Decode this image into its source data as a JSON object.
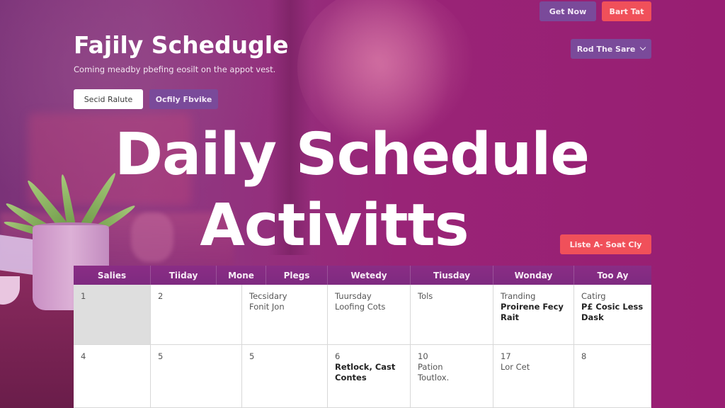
{
  "header": {
    "buttons": {
      "get_now": "Get Now",
      "start_tab": "Bart Tat",
      "read_select": "Rod The Sare"
    },
    "title": "Fajily Schedugle",
    "subtitle": "Coming meadby pbefing eosilt on the appot vest.",
    "primary_button": "Secid Ralute",
    "secondary_button": "Ocfily Fbvike"
  },
  "hero": {
    "line1": "Daily Schedule",
    "line2": "Activitts"
  },
  "list_button": "Liste A- Soat Cly",
  "colors": {
    "background": "#962074",
    "button_purple": "#7a4a9a",
    "button_red": "#f0505a",
    "table_header": "#8a2d85"
  },
  "table": {
    "headers": [
      "Salies",
      "Tiiday",
      "Mone",
      "Plegs",
      "Wetedy",
      "Tiusday",
      "Wonday",
      "Too Ay"
    ],
    "rows": [
      [
        {
          "num": "1",
          "lines": [],
          "bold": []
        },
        {
          "num": "2",
          "lines": [],
          "bold": []
        },
        {
          "num": "",
          "lines": [
            "Tecsidary",
            "Fonit Jon"
          ],
          "bold": []
        },
        {
          "num": "",
          "lines": [
            "Tuursday",
            "Loofing Cots"
          ],
          "bold": []
        },
        {
          "num": "",
          "lines": [
            "Tols"
          ],
          "bold": []
        },
        {
          "num": "",
          "lines": [
            "Tranding"
          ],
          "bold": [
            "Proirene Fecy",
            "Rait"
          ]
        },
        {
          "num": "",
          "lines": [
            "Catirg"
          ],
          "bold": [
            "P£ Cosic Less",
            "Dask"
          ]
        }
      ],
      [
        {
          "num": "4",
          "lines": [],
          "bold": []
        },
        {
          "num": "5",
          "lines": [],
          "bold": []
        },
        {
          "num": "5",
          "lines": [],
          "bold": []
        },
        {
          "num": "6",
          "lines": [],
          "bold": [
            "Retlock, Cast",
            "Contes"
          ]
        },
        {
          "num": "10",
          "lines": [
            "Pation",
            "Toutlox."
          ],
          "bold": []
        },
        {
          "num": "17",
          "lines": [
            "Lor Cet"
          ],
          "bold": []
        },
        {
          "num": "8",
          "lines": [],
          "bold": []
        }
      ]
    ]
  }
}
